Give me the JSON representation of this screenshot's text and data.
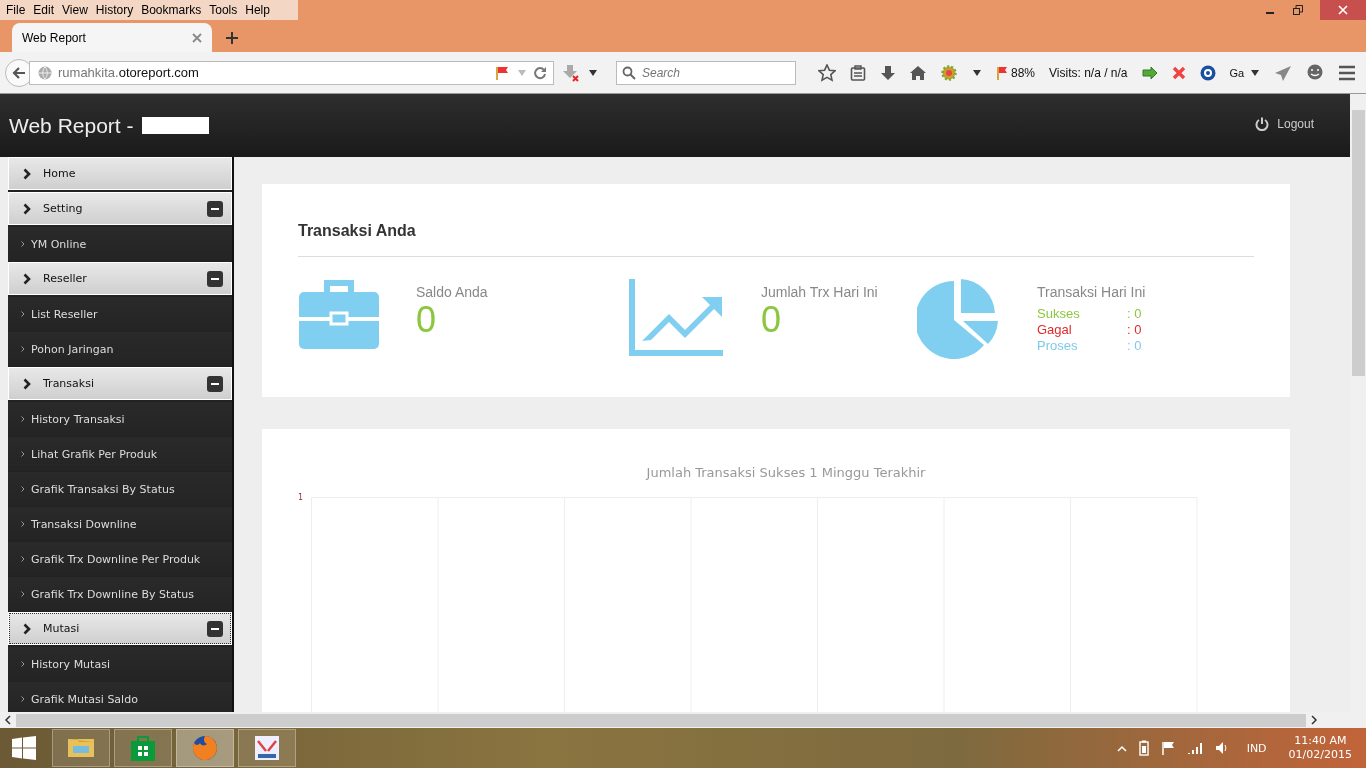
{
  "browser": {
    "menu": [
      "File",
      "Edit",
      "View",
      "History",
      "Bookmarks",
      "Tools",
      "Help"
    ],
    "tabs": [
      {
        "title": "Web Report",
        "selected": true
      }
    ],
    "address": {
      "prefix": "rumahkita.",
      "domain": "otoreport.com"
    },
    "search": {
      "placeholder": "Search"
    },
    "toolbar": {
      "zoom": "88%",
      "visits": "Visits: n/a / n/a",
      "lang": "Ga"
    }
  },
  "page": {
    "brand": "Web Report -",
    "logout": "Logout",
    "sidebar": [
      {
        "kind": "header",
        "label": "Home",
        "focused": false
      },
      {
        "kind": "section",
        "label": "Setting",
        "expanded": true,
        "focused": false
      },
      {
        "kind": "link",
        "label": "YM Online"
      },
      {
        "kind": "section",
        "label": "Reseller",
        "expanded": true,
        "focused": false
      },
      {
        "kind": "link",
        "label": "List Reseller"
      },
      {
        "kind": "link",
        "label": "Pohon Jaringan"
      },
      {
        "kind": "section",
        "label": "Transaksi",
        "expanded": true,
        "focused": false
      },
      {
        "kind": "link",
        "label": "History Transaksi"
      },
      {
        "kind": "link",
        "label": "Lihat Grafik Per Produk"
      },
      {
        "kind": "link",
        "label": "Grafik Transaksi By Status"
      },
      {
        "kind": "link",
        "label": "Transaksi Downline"
      },
      {
        "kind": "link",
        "label": "Grafik Trx Downline Per Produk"
      },
      {
        "kind": "link",
        "label": "Grafik Trx Downline By Status"
      },
      {
        "kind": "section",
        "label": "Mutasi",
        "expanded": true,
        "focused": true
      },
      {
        "kind": "link",
        "label": "History Mutasi"
      },
      {
        "kind": "link",
        "label": "Grafik Mutasi Saldo"
      }
    ],
    "summary": {
      "title": "Transaksi Anda",
      "stats": [
        {
          "kind": "amount",
          "label": "Saldo Anda",
          "value": "0"
        },
        {
          "kind": "amount",
          "label": "Jumlah Trx Hari Ini",
          "value": "0"
        },
        {
          "kind": "breakdown",
          "label": "Transaksi Hari Ini",
          "rows": [
            {
              "label": "Sukses",
              "value": ": 0",
              "color": "#8cc63e"
            },
            {
              "label": "Gagal",
              "value": ": 0",
              "color": "#e02b2b"
            },
            {
              "label": "Proses",
              "value": ": 0",
              "color": "#7ccbea"
            }
          ]
        }
      ]
    },
    "chart": {
      "title": "Jumlah Transaksi Sukses 1 Minggu Terakhir",
      "y_tick": "1"
    }
  },
  "taskbar": {
    "language": "IND",
    "time": "11:40 AM",
    "date": "01/02/2015"
  }
}
